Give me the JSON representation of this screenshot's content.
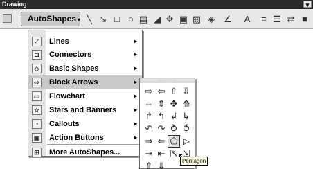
{
  "window": {
    "title": "Drawing"
  },
  "toolbar": {
    "autoshapes_label": "AutoShapes",
    "autoshapes_arrow": "▾",
    "tools": [
      {
        "name": "line-tool-icon",
        "glyph": "╲"
      },
      {
        "name": "arrow-tool-icon",
        "glyph": "↘"
      },
      {
        "name": "rectangle-tool-icon",
        "glyph": "□"
      },
      {
        "name": "oval-tool-icon",
        "glyph": "○"
      },
      {
        "name": "textbox-tool-icon",
        "glyph": "▤"
      },
      {
        "name": "wordart-tool-icon",
        "glyph": "◢"
      },
      {
        "name": "diagram-tool-icon",
        "glyph": "✥"
      },
      {
        "name": "clipart-tool-icon",
        "glyph": "▣"
      },
      {
        "name": "picture-tool-icon",
        "glyph": "▨"
      },
      {
        "name": "fill-color-tool-icon",
        "glyph": "◈"
      },
      {
        "name": "line-color-tool-icon",
        "glyph": "∠"
      },
      {
        "name": "font-color-tool-icon",
        "glyph": "A"
      },
      {
        "name": "line-style-tool-icon",
        "glyph": "≡"
      },
      {
        "name": "dash-style-tool-icon",
        "glyph": "☰"
      },
      {
        "name": "arrow-style-tool-icon",
        "glyph": "⇄"
      },
      {
        "name": "shadow-tool-icon",
        "glyph": "■"
      }
    ]
  },
  "menu": {
    "items": [
      {
        "label": "Lines",
        "icon": "lines-icon",
        "glyph": "⟋",
        "submenu": "▸"
      },
      {
        "label": "Connectors",
        "icon": "connectors-icon",
        "glyph": "⊐",
        "submenu": "▸"
      },
      {
        "label": "Basic Shapes",
        "icon": "basic-shapes-icon",
        "glyph": "◇",
        "submenu": "▸"
      },
      {
        "label": "Block Arrows",
        "icon": "block-arrows-icon",
        "glyph": "⇨",
        "submenu": "▸"
      },
      {
        "label": "Flowchart",
        "icon": "flowchart-icon",
        "glyph": "▭",
        "submenu": "▸"
      },
      {
        "label": "Stars and Banners",
        "icon": "stars-banners-icon",
        "glyph": "☆",
        "submenu": "▸"
      },
      {
        "label": "Callouts",
        "icon": "callouts-icon",
        "glyph": "◔",
        "submenu": "▸"
      },
      {
        "label": "Action Buttons",
        "icon": "action-buttons-icon",
        "glyph": "▣",
        "submenu": "▸"
      },
      {
        "label": "More AutoShapes...",
        "icon": "more-autoshapes-icon",
        "glyph": "⊞",
        "submenu": ""
      }
    ]
  },
  "submenu": {
    "grip": "·········",
    "rows": [
      [
        "⇨",
        "⇦",
        "⇧",
        "⇩"
      ],
      [
        "⇔",
        "⇕",
        "✥",
        "⟰"
      ],
      [
        "↱",
        "↰",
        "↲",
        "↳"
      ],
      [
        "↶",
        "↷",
        "⥁",
        "⥀"
      ],
      [
        "⇒",
        "⇐",
        "⬠",
        "▷"
      ],
      [
        "⇥",
        "⇤",
        "⇱",
        "⇲"
      ],
      [
        "⇑",
        "⇓",
        "",
        ""
      ]
    ],
    "selected_label": "Pentagon"
  },
  "tooltip": {
    "text": "Pentagon"
  }
}
